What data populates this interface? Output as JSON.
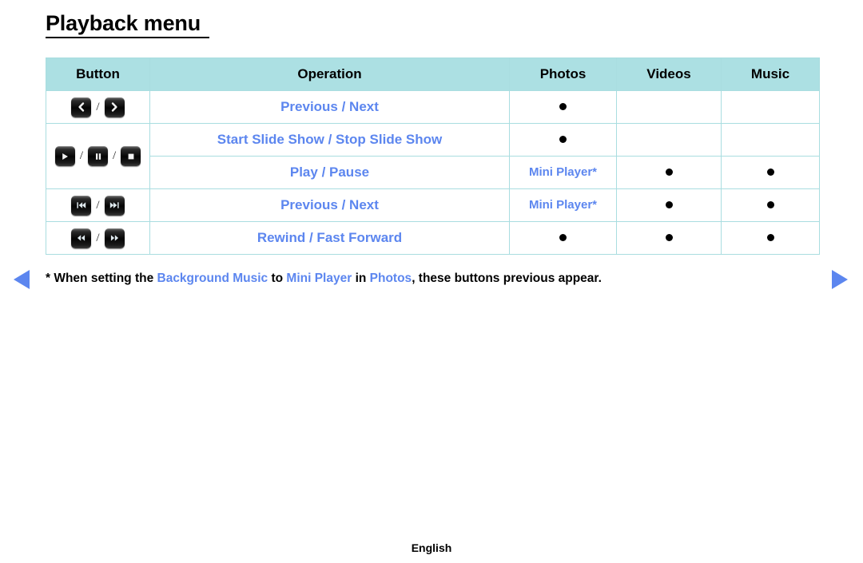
{
  "page": {
    "title": "Playback menu",
    "language_footer": "English"
  },
  "table": {
    "headers": [
      "Button",
      "Operation",
      "Photos",
      "Videos",
      "Music"
    ],
    "rows": [
      {
        "buttons": [
          "chevron-left",
          "chevron-right"
        ],
        "button_separator": "/",
        "operation": "Previous / Next",
        "photos": "dot",
        "videos": "",
        "music": ""
      },
      {
        "buttons": [
          "play",
          "pause",
          "stop"
        ],
        "button_separator": "/",
        "operation": "Start Slide Show / Stop Slide Show",
        "photos": "dot",
        "videos": "",
        "music": ""
      },
      {
        "buttons": [],
        "button_separator": "/",
        "operation": "Play / Pause",
        "photos": "Mini Player*",
        "videos": "dot",
        "music": "dot"
      },
      {
        "buttons": [
          "skip-previous",
          "skip-next"
        ],
        "button_separator": "/",
        "operation": "Previous / Next",
        "photos": "Mini Player*",
        "videos": "dot",
        "music": "dot"
      },
      {
        "buttons": [
          "rewind",
          "fast-forward"
        ],
        "button_separator": "/",
        "operation": "Rewind / Fast Forward",
        "photos": "dot",
        "videos": "dot",
        "music": "dot"
      }
    ]
  },
  "footnote": {
    "part1": "* When setting the ",
    "hl1": "Background Music",
    "part2": " to ",
    "hl2": "Mini Player",
    "part3": " in ",
    "hl3": "Photos",
    "part4": ", these buttons previous appear."
  },
  "nav": {
    "prev_label": "previous-page",
    "next_label": "next-page"
  },
  "colors": {
    "header_bg": "#ace0e3",
    "border": "#a9dde0",
    "link_blue": "#5c86ef",
    "text": "#000000"
  }
}
